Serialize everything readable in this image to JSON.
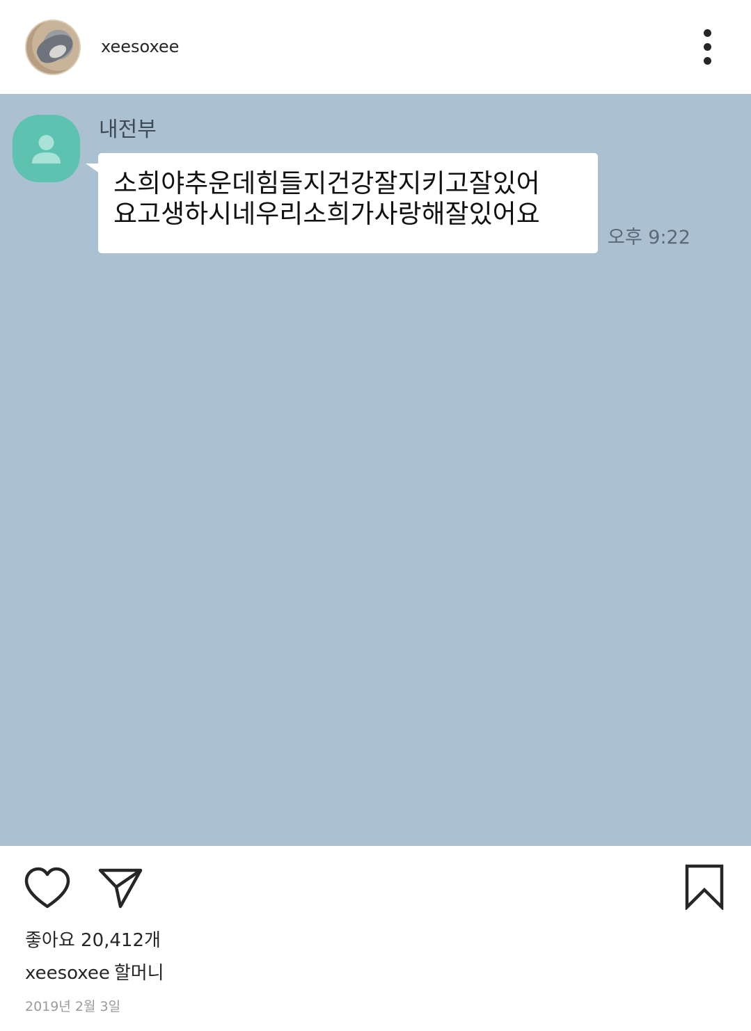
{
  "header": {
    "username": "xeesoxee"
  },
  "chat": {
    "sender_name": "내전부",
    "message_lines": [
      "소희야추운데힘들지건강잘지키고잘있어",
      "요고생하시네우리소희가사랑해잘있어요"
    ],
    "time": "오후 9:22",
    "background_color": "#abc1d1",
    "profile_color": "#5ec2b0"
  },
  "actions": {
    "like_icon": "heart-icon",
    "share_icon": "paper-plane-icon",
    "bookmark_icon": "bookmark-icon"
  },
  "meta": {
    "likes": "좋아요 20,412개",
    "caption_user": "xeesoxee",
    "caption_text": "할머니",
    "date": "2019년 2월 3일"
  }
}
